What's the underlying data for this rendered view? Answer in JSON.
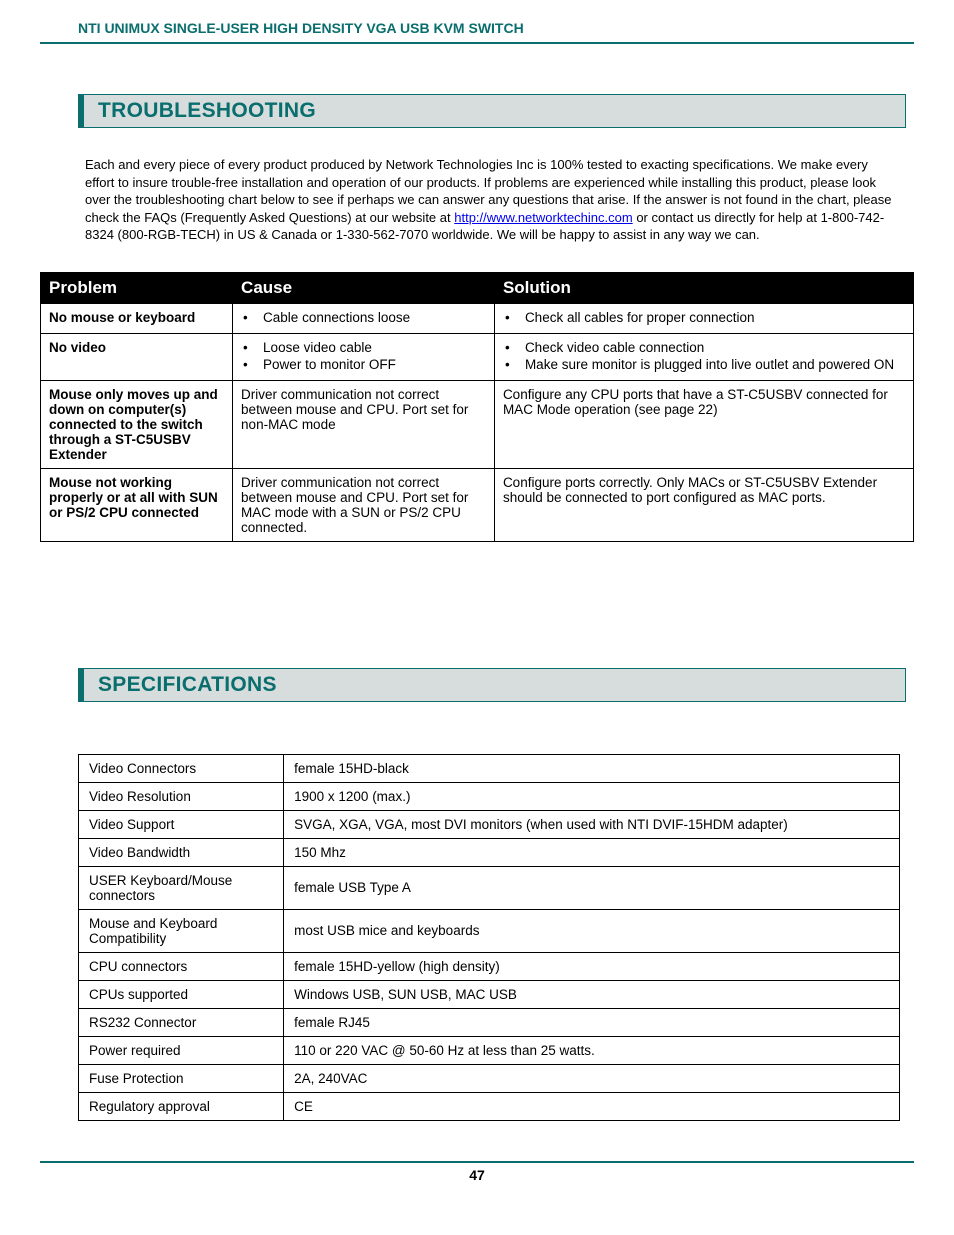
{
  "header": {
    "title": "NTI UNIMUX SINGLE-USER HIGH DENSITY VGA USB KVM SWITCH"
  },
  "section1": {
    "heading": "TROUBLESHOOTING",
    "intro_pre": "Each and every piece of every product produced by Network Technologies Inc is 100% tested to exacting specifications.   We make every effort to insure trouble-free installation and operation of our products. If problems are experienced while installing this product, please look over the troubleshooting chart below to see if perhaps we can answer any questions that arise.    If the answer is not found in the chart, please check the FAQs (Frequently Asked Questions) at our website at ",
    "link_text": "http://www.networktechinc.com",
    "intro_post": " or contact us directly for help at 1-800-742-8324 (800-RGB-TECH) in US & Canada or 1-330-562-7070 worldwide.    We will be happy to assist in any way we can."
  },
  "trouble_table": {
    "headers": {
      "problem": "Problem",
      "cause": "Cause",
      "solution": "Solution"
    },
    "rows": [
      {
        "problem": "No mouse or keyboard",
        "causes": [
          "Cable connections loose"
        ],
        "solutions": [
          "Check all cables for proper connection"
        ]
      },
      {
        "problem": "No video",
        "causes": [
          "Loose video cable",
          "Power to monitor OFF"
        ],
        "solutions": [
          "Check video cable connection",
          "Make sure monitor is plugged into live outlet and powered ON"
        ]
      },
      {
        "problem": "Mouse only moves up and down on computer(s) connected to the switch through a ST-C5USBV Extender",
        "cause_text": "Driver communication not correct between mouse and CPU.   Port set for non-MAC mode",
        "solution_text": "Configure any CPU ports that have a ST-C5USBV connected for MAC Mode operation (see page 22)"
      },
      {
        "problem": "Mouse not working properly or at all with SUN or PS/2 CPU connected",
        "cause_text": "Driver communication not correct between mouse and CPU.   Port set for MAC mode with a SUN or PS/2 CPU connected.",
        "solution_text": "Configure ports correctly.   Only MACs or ST-C5USBV Extender should be connected to port configured as MAC ports."
      }
    ]
  },
  "section2": {
    "heading": "SPECIFICATIONS"
  },
  "spec_table": {
    "rows": [
      {
        "label": "Video Connectors",
        "value": "female 15HD-black"
      },
      {
        "label": "Video Resolution",
        "value": "1900 x 1200 (max.)"
      },
      {
        "label": "Video Support",
        "value": "SVGA, XGA, VGA, most DVI monitors (when used with NTI DVIF-15HDM adapter)"
      },
      {
        "label": "Video Bandwidth",
        "value": "150 Mhz"
      },
      {
        "label": "USER Keyboard/Mouse connectors",
        "value": "female USB Type A"
      },
      {
        "label": "Mouse and Keyboard Compatibility",
        "value": "most USB mice and keyboards"
      },
      {
        "label": "CPU connectors",
        "value": "female 15HD-yellow (high density)"
      },
      {
        "label": "CPUs supported",
        "value": "Windows USB, SUN USB, MAC USB"
      },
      {
        "label": "RS232 Connector",
        "value": "female RJ45"
      },
      {
        "label": "Power required",
        "value": "110 or 220 VAC @ 50-60 Hz at less than 25 watts."
      },
      {
        "label": "Fuse Protection",
        "value": "2A, 240VAC"
      },
      {
        "label": "Regulatory approval",
        "value": "CE"
      }
    ]
  },
  "footer": {
    "page": "47"
  }
}
